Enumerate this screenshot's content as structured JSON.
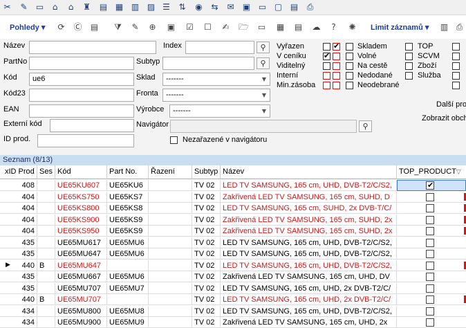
{
  "toolbar_top": {
    "icons": [
      "tools-icon",
      "user-tools-icon",
      "computer-icon",
      "cart-icon",
      "cart-settings-icon",
      "trophy-icon",
      "document-icon",
      "calculator-icon",
      "document-list-icon",
      "archive-icon",
      "sort-digits-icon",
      "radio-icon",
      "transfer-icon",
      "message-icon",
      "basket-icon",
      "monitor-icon",
      "window-icon",
      "form-icon",
      "printer-icon"
    ]
  },
  "toolbar_second": {
    "pohledy_label": "Pohledy",
    "limit_label": "Limit záznamů",
    "icons": [
      "refresh-icon",
      "clipboard-c-icon",
      "calendar-export-icon",
      "filter-icon",
      "edit-icon",
      "add-document-icon",
      "pdf-icon",
      "checklist-icon",
      "check-disabled-icon",
      "edit-list-icon",
      "folder-open-icon",
      "screen-delete-icon",
      "table-icon",
      "table-alt-icon",
      "cloud-icon",
      "help-note-icon",
      "sun-settings-icon",
      "grid-settings-icon",
      "print-icon"
    ]
  },
  "filters": {
    "nazev_label": "Název",
    "partno_label": "PartNo",
    "kod_label": "Kód",
    "kod_value": "ue6",
    "kod23_label": "Kód23",
    "ean_label": "EAN",
    "extkod_label": "Externí kód",
    "idprod_label": "ID prod.",
    "index_label": "Index",
    "subtyp_label": "Subtyp",
    "sklad_label": "Sklad",
    "sklad_value": "-------",
    "fronta_label": "Fronta",
    "fronta_value": "-------",
    "vyrobce_label": "Výrobce",
    "vyrobce_value": "-------",
    "navigator_label": "Navigátor",
    "nezarazene_label": "Nezařazené v navigátoru",
    "vyrazen_label": "Vyřazen",
    "vceniku_label": "V ceníku",
    "viditelny_label": "Viditelný",
    "interni_label": "Interní",
    "minzasoba_label": "Min.zásoba",
    "skladem_label": "Skladem",
    "volne_label": "Volné",
    "nacest_label": "Na cestě",
    "nedodane_label": "Nedodané",
    "neodebrane_label": "Neodebrané",
    "top_label": "TOP",
    "scvm_label": "SCVM",
    "zbozi_label": "Zboží",
    "sluzba_label": "Služba",
    "dalsi_label": "Další prod",
    "zobrazit_label": "Zobrazit obch"
  },
  "list": {
    "title": "Seznam (8/13)",
    "columns": [
      "xID Prod",
      "Ses",
      "Kód",
      "Part No.",
      "Řazení",
      "Subtyp",
      "Název",
      "TOP_PRODUCT"
    ],
    "rows": [
      {
        "id": "408",
        "ses": "",
        "kod": "UE65KU607",
        "partno": "UE65KU6",
        "razeni": "",
        "subtyp": "TV 02",
        "nazev": "LED TV SAMSUNG, 165 cm, UHD, DVB-T2/C/S2,",
        "red": true,
        "checked": true,
        "selected": true,
        "current": false
      },
      {
        "id": "404",
        "ses": "",
        "kod": "UE65KS750",
        "partno": "UE65KS7",
        "razeni": "",
        "subtyp": "TV 02",
        "nazev": "Zakřivená LED TV SAMSUNG, 165 cm, SUHD, D",
        "red": true,
        "checked": false,
        "selected": false,
        "current": false
      },
      {
        "id": "404",
        "ses": "",
        "kod": "UE65KS800",
        "partno": "UE65KS8",
        "razeni": "",
        "subtyp": "TV 02",
        "nazev": "LED TV SAMSUNG, 165 cm, SUHD, 2x DVB-T/C/",
        "red": true,
        "checked": false,
        "selected": false,
        "current": false
      },
      {
        "id": "404",
        "ses": "",
        "kod": "UE65KS900",
        "partno": "UE65KS9",
        "razeni": "",
        "subtyp": "TV 02",
        "nazev": "Zakřivená LED TV SAMSUNG, 165 cm, SUHD, 2x",
        "red": true,
        "checked": false,
        "selected": false,
        "current": false
      },
      {
        "id": "404",
        "ses": "",
        "kod": "UE65KS950",
        "partno": "UE65KS9",
        "razeni": "",
        "subtyp": "TV 02",
        "nazev": "Zakřivená LED TV SAMSUNG, 165 cm, SUHD, 2x",
        "red": true,
        "checked": false,
        "selected": false,
        "current": false
      },
      {
        "id": "435",
        "ses": "",
        "kod": "UE65MU617",
        "partno": "UE65MU6",
        "razeni": "",
        "subtyp": "TV 02",
        "nazev": "LED TV SAMSUNG, 165 cm, UHD, DVB-T2/C/S2,",
        "red": false,
        "checked": false,
        "selected": false,
        "current": false
      },
      {
        "id": "435",
        "ses": "",
        "kod": "UE65MU647",
        "partno": "UE65MU6",
        "razeni": "",
        "subtyp": "TV 02",
        "nazev": "LED TV SAMSUNG, 165 cm, UHD, DVB-T2/C/S2,",
        "red": false,
        "checked": false,
        "selected": false,
        "current": false
      },
      {
        "id": "440",
        "ses": "B",
        "kod": "UE65MU647",
        "partno": "",
        "razeni": "",
        "subtyp": "TV 02",
        "nazev": "LED TV SAMSUNG, 165 cm, UHD, DVB-T2/C/S2,",
        "red": true,
        "checked": false,
        "selected": false,
        "current": true
      },
      {
        "id": "435",
        "ses": "",
        "kod": "UE65MU667",
        "partno": "UE65MU6",
        "razeni": "",
        "subtyp": "TV 02",
        "nazev": "Zakřivená LED TV SAMSUNG, 165 cm, UHD, DV",
        "red": false,
        "checked": false,
        "selected": false,
        "current": false
      },
      {
        "id": "435",
        "ses": "",
        "kod": "UE65MU707",
        "partno": "UE65MU7",
        "razeni": "",
        "subtyp": "TV 02",
        "nazev": "LED TV SAMSUNG, 165 cm, UHD, 2x DVB-T2/C/",
        "red": false,
        "checked": false,
        "selected": false,
        "current": false
      },
      {
        "id": "440",
        "ses": "B",
        "kod": "UE65MU707",
        "partno": "",
        "razeni": "",
        "subtyp": "TV 02",
        "nazev": "LED TV SAMSUNG, 165 cm, UHD, 2x DVB-T2/C/",
        "red": true,
        "checked": false,
        "selected": false,
        "current": false
      },
      {
        "id": "434",
        "ses": "",
        "kod": "UE65MU800",
        "partno": "UE65MU8",
        "razeni": "",
        "subtyp": "TV 02",
        "nazev": "LED TV SAMSUNG, 165 cm, UHD, DVB-T2/C/S2,",
        "red": false,
        "checked": false,
        "selected": false,
        "current": false
      },
      {
        "id": "434",
        "ses": "",
        "kod": "UE65MU900",
        "partno": "UE65MU9",
        "razeni": "",
        "subtyp": "TV 02",
        "nazev": "Zakřivená LED TV SAMSUNG, 165 cm, UHD, 2x",
        "red": false,
        "checked": false,
        "selected": false,
        "current": false
      }
    ]
  },
  "colors": {
    "accent": "#1f3f9f",
    "red_text": "#d01818",
    "header_band": "#c9def1",
    "selection": "#cfe4fb"
  }
}
